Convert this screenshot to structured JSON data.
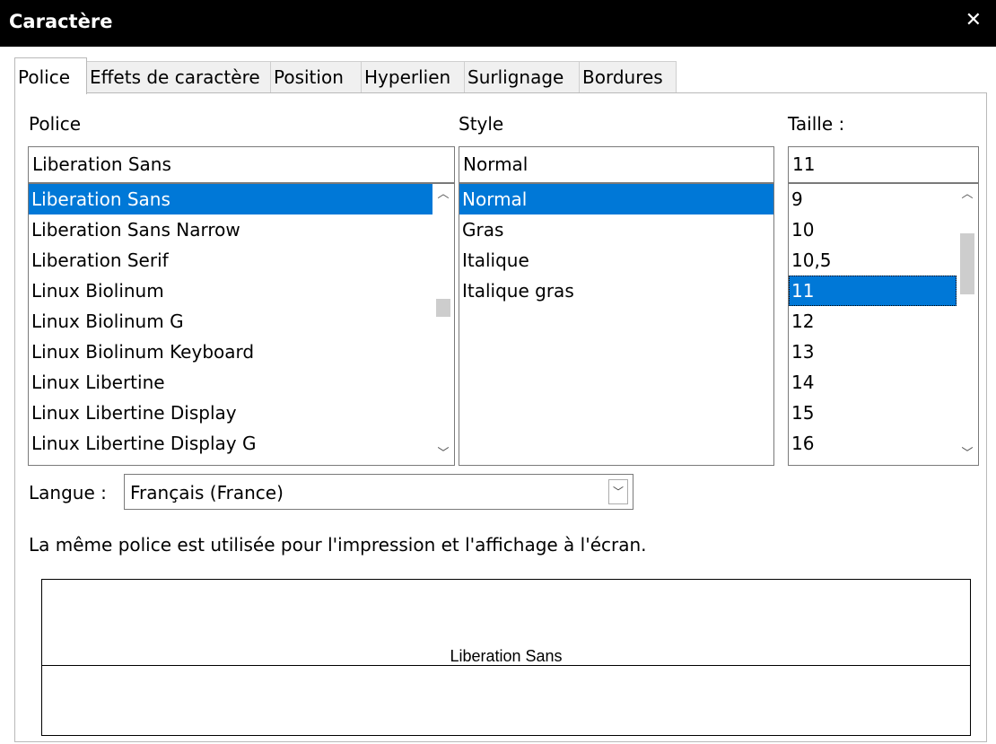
{
  "window": {
    "title": "Caractère"
  },
  "tabs": [
    {
      "label": "Police",
      "active": true
    },
    {
      "label": "Effets de caractère"
    },
    {
      "label": "Position"
    },
    {
      "label": "Hyperlien"
    },
    {
      "label": "Surlignage"
    },
    {
      "label": "Bordures"
    }
  ],
  "font": {
    "label": "Police",
    "value": "Liberation Sans",
    "list": [
      "Liberation Sans",
      "Liberation Sans Narrow",
      "Liberation Serif",
      "Linux Biolinum",
      "Linux Biolinum G",
      "Linux Biolinum Keyboard",
      "Linux Libertine",
      "Linux Libertine Display",
      "Linux Libertine Display G"
    ],
    "selected_index": 0
  },
  "style": {
    "label": "Style",
    "value": "Normal",
    "list": [
      "Normal",
      "Gras",
      "Italique",
      "Italique gras"
    ],
    "selected_index": 0
  },
  "size": {
    "label": "Taille :",
    "value": "11",
    "list": [
      "9",
      "10",
      "10,5",
      "11",
      "12",
      "13",
      "14",
      "15",
      "16"
    ],
    "selected_index": 3
  },
  "language": {
    "label": "Langue :",
    "value": "Français (France)"
  },
  "info_text": "La même police est utilisée pour l'impression et l'affichage à l'écran.",
  "preview": {
    "text": "Liberation Sans"
  },
  "icons": {
    "close": "close-icon",
    "scroll_up": "chevron-up-icon",
    "scroll_down": "chevron-down-icon",
    "dropdown": "chevron-down-icon"
  },
  "colors": {
    "selection": "#0078d7",
    "titlebar": "#000000"
  }
}
